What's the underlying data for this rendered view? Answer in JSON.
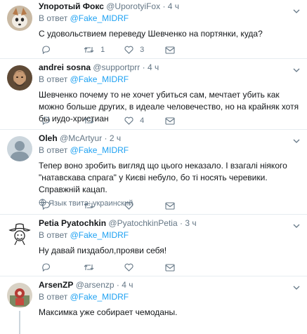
{
  "reply_prefix": "В ответ",
  "tweets": [
    {
      "name": "Упоротый Фокс",
      "handle": "@UporotyiFox",
      "time": "4 ч",
      "reply_to": "@Fake_MIDRF",
      "text": "С удовольствием переведу Шевченко на портянки, куда?",
      "reply_count": "",
      "retweet_count": "1",
      "like_count": "3",
      "avatar": "fox-avatar"
    },
    {
      "name": "andrei sosna",
      "handle": "@supportprr",
      "time": "4 ч",
      "reply_to": "@Fake_MIDRF",
      "text": "Шевченко почему то не хочет убиться сам, мечтает убить как можно больше других, в идеале человечество, но на крайняк хотя бы иудо-христиан",
      "reply_count": "",
      "retweet_count": "",
      "like_count": "4",
      "avatar": "man-photo-avatar"
    },
    {
      "name": "Oleh",
      "handle": "@McArtyur",
      "time": "2 ч",
      "reply_to": "@Fake_MIDRF",
      "text": "Тепер воно зробить вигляд що цього неказало. І взагалі ніякого \"натавскава спрага\" у Києві небуло, бо ті носять черевики. Справжній кацап.",
      "translate": "Язык твита: украинский",
      "reply_count": "",
      "retweet_count": "",
      "like_count": "",
      "avatar": "default-avatar"
    },
    {
      "name": "Petia Pyatochkin",
      "handle": "@PyatochkinPetia",
      "time": "3 ч",
      "reply_to": "@Fake_MIDRF",
      "text": "Ну давай пиздабол,прояви себя!",
      "reply_count": "",
      "retweet_count": "",
      "like_count": "",
      "avatar": "cowboy-avatar"
    },
    {
      "name": "ArsenZP",
      "handle": "@arsenzp",
      "time": "4 ч",
      "reply_to": "@Fake_MIDRF",
      "text": "Максимка уже собирает чемоданы.",
      "avatar": "arsen-avatar"
    }
  ],
  "colors": {
    "link": "#1da1f2",
    "muted": "#657786",
    "text": "#14171a",
    "divider": "#e6ecf0"
  }
}
